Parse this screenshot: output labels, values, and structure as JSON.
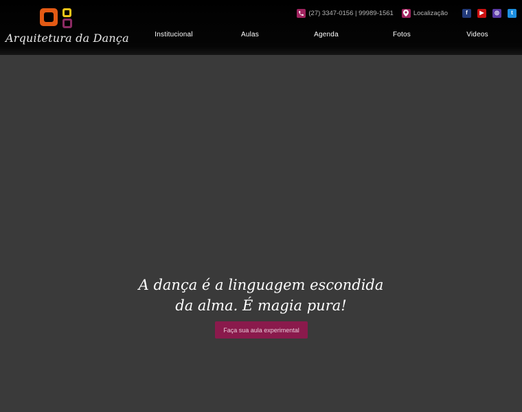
{
  "brand": {
    "logo_text": "Arquitetura da Dança",
    "colors": {
      "orange": "#e35a14",
      "yellow": "#f0c419",
      "purple": "#8c2a63"
    }
  },
  "topbar": {
    "phone_icon": "phone-icon",
    "phone_text": "(27) 3347-0156 | 99989-1561",
    "location_icon": "map-pin-icon",
    "location_text": "Localização",
    "social": [
      {
        "name": "facebook-icon",
        "glyph": "f"
      },
      {
        "name": "youtube-icon",
        "glyph": "▶"
      },
      {
        "name": "instagram-icon",
        "glyph": "◎"
      },
      {
        "name": "twitter-icon",
        "glyph": "t"
      }
    ]
  },
  "nav": {
    "items": [
      "Institucional",
      "Aulas",
      "Agenda",
      "Fotos",
      "Videos"
    ]
  },
  "hero": {
    "tagline_line1": "A dança é a linguagem escondida",
    "tagline_line2": "da alma. É magia pura!",
    "cta_label": "Faça sua aula experimental",
    "accent_color": "#8a1a4c"
  }
}
